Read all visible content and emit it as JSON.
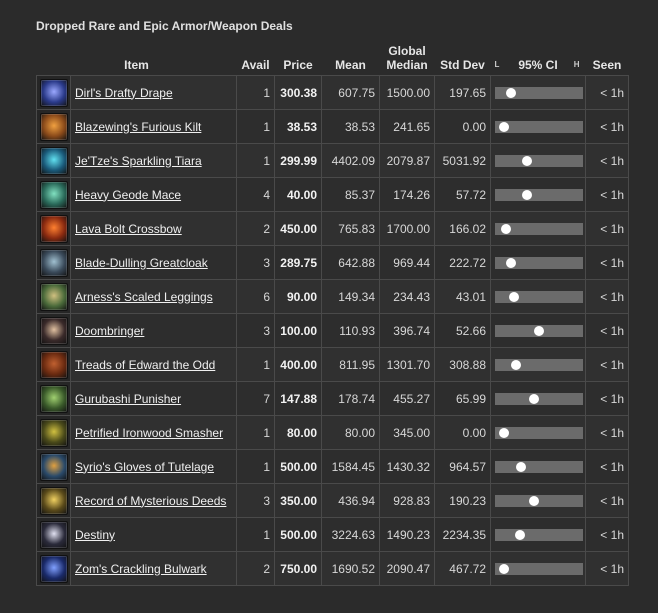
{
  "page": {
    "title": "Dropped Rare and Epic Armor/Weapon Deals"
  },
  "columns": {
    "item": "Item",
    "avail": "Avail",
    "price": "Price",
    "mean": "Mean",
    "global_median_1": "Global",
    "global_median_2": "Median",
    "std_dev": "Std Dev",
    "ci_low": "L",
    "ci": "95% CI",
    "ci_high": "H",
    "seen": "Seen"
  },
  "rows": [
    {
      "name": "Dirl's Drafty Drape",
      "avail": "1",
      "price": "300.38",
      "mean": "607.75",
      "median": "1500.00",
      "std": "197.65",
      "ci": 0.18,
      "seen": "< 1h",
      "icon": "cloak-icon",
      "color": "#2a3a8a",
      "accent": "#9aa8ff"
    },
    {
      "name": "Blazewing's Furious Kilt",
      "avail": "1",
      "price": "38.53",
      "mean": "38.53",
      "median": "241.65",
      "std": "0.00",
      "ci": 0.1,
      "seen": "< 1h",
      "icon": "kilt-icon",
      "color": "#8a4a1a",
      "accent": "#f0a040"
    },
    {
      "name": "Je'Tze's Sparkling Tiara",
      "avail": "1",
      "price": "299.99",
      "mean": "4402.09",
      "median": "2079.87",
      "std": "5031.92",
      "ci": 0.36,
      "seen": "< 1h",
      "icon": "tiara-icon",
      "color": "#1a5a7a",
      "accent": "#60e0f0"
    },
    {
      "name": "Heavy Geode Mace",
      "avail": "4",
      "price": "40.00",
      "mean": "85.37",
      "median": "174.26",
      "std": "57.72",
      "ci": 0.36,
      "seen": "< 1h",
      "icon": "mace-icon",
      "color": "#2a6a5a",
      "accent": "#80e0c0"
    },
    {
      "name": "Lava Bolt Crossbow",
      "avail": "2",
      "price": "450.00",
      "mean": "765.83",
      "median": "1700.00",
      "std": "166.02",
      "ci": 0.12,
      "seen": "< 1h",
      "icon": "crossbow-icon",
      "color": "#8a2a10",
      "accent": "#ff8030"
    },
    {
      "name": "Blade-Dulling Greatcloak",
      "avail": "3",
      "price": "289.75",
      "mean": "642.88",
      "median": "969.44",
      "std": "222.72",
      "ci": 0.18,
      "seen": "< 1h",
      "icon": "greatcloak-icon",
      "color": "#3a4a5a",
      "accent": "#a0c0d0"
    },
    {
      "name": "Arness's Scaled Leggings",
      "avail": "6",
      "price": "90.00",
      "mean": "149.34",
      "median": "234.43",
      "std": "43.01",
      "ci": 0.22,
      "seen": "< 1h",
      "icon": "leggings-icon",
      "color": "#4a6a3a",
      "accent": "#d0c080"
    },
    {
      "name": "Doombringer",
      "avail": "3",
      "price": "100.00",
      "mean": "110.93",
      "median": "396.74",
      "std": "52.66",
      "ci": 0.5,
      "seen": "< 1h",
      "icon": "sword-icon",
      "color": "#3a2a2a",
      "accent": "#e0c0a0"
    },
    {
      "name": "Treads of Edward the Odd",
      "avail": "1",
      "price": "400.00",
      "mean": "811.95",
      "median": "1301.70",
      "std": "308.88",
      "ci": 0.24,
      "seen": "< 1h",
      "icon": "boots-icon",
      "color": "#6a2a10",
      "accent": "#c06030"
    },
    {
      "name": "Gurubashi Punisher",
      "avail": "7",
      "price": "147.88",
      "mean": "178.74",
      "median": "455.27",
      "std": "65.99",
      "ci": 0.44,
      "seen": "< 1h",
      "icon": "punisher-icon",
      "color": "#3a5a2a",
      "accent": "#a0d070"
    },
    {
      "name": "Petrified Ironwood Smasher",
      "avail": "1",
      "price": "80.00",
      "mean": "80.00",
      "median": "345.00",
      "std": "0.00",
      "ci": 0.1,
      "seen": "< 1h",
      "icon": "hammer-icon",
      "color": "#4a4a1a",
      "accent": "#d0c040"
    },
    {
      "name": "Syrio's Gloves of Tutelage",
      "avail": "1",
      "price": "500.00",
      "mean": "1584.45",
      "median": "1430.32",
      "std": "964.57",
      "ci": 0.3,
      "seen": "< 1h",
      "icon": "gloves-icon",
      "color": "#2a4a6a",
      "accent": "#e0a040"
    },
    {
      "name": "Record of Mysterious Deeds",
      "avail": "3",
      "price": "350.00",
      "mean": "436.94",
      "median": "928.83",
      "std": "190.23",
      "ci": 0.44,
      "seen": "< 1h",
      "icon": "scroll-icon",
      "color": "#5a4a1a",
      "accent": "#f0d060"
    },
    {
      "name": "Destiny",
      "avail": "1",
      "price": "500.00",
      "mean": "3224.63",
      "median": "1490.23",
      "std": "2234.35",
      "ci": 0.28,
      "seen": "< 1h",
      "icon": "greatsword-icon",
      "color": "#2a2a3a",
      "accent": "#e0e0f0"
    },
    {
      "name": "Zom's Crackling Bulwark",
      "avail": "2",
      "price": "750.00",
      "mean": "1690.52",
      "median": "2090.47",
      "std": "467.72",
      "ci": 0.1,
      "seen": "< 1h",
      "icon": "shield-icon",
      "color": "#1a2a6a",
      "accent": "#80a0ff"
    }
  ]
}
